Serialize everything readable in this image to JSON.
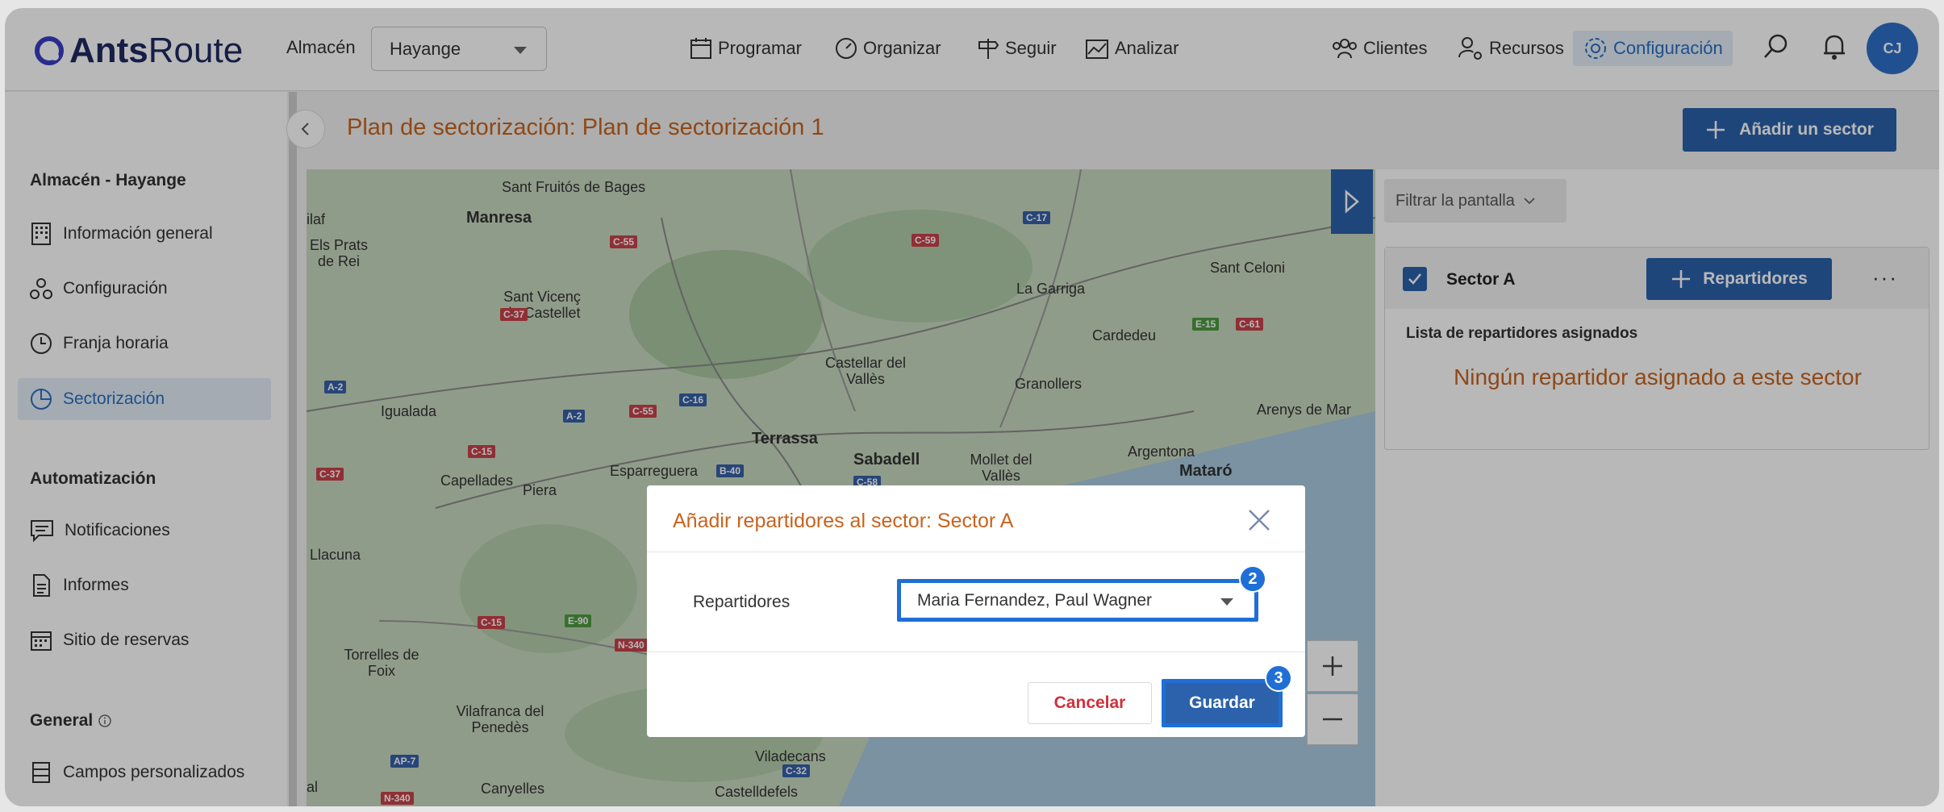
{
  "app": {
    "logo_bold": "Ants",
    "logo_rest": "Route"
  },
  "header": {
    "warehouse_label": "Almacén",
    "warehouse_value": "Hayange",
    "nav": {
      "programar": "Programar",
      "organizar": "Organizar",
      "seguir": "Seguir",
      "analizar": "Analizar",
      "clientes": "Clientes",
      "recursos": "Recursos",
      "configuracion": "Configuración"
    },
    "avatar": "CJ"
  },
  "sidebar": {
    "section1": "Almacén - Hayange",
    "items1": [
      "Información general",
      "Configuración",
      "Franja horaria",
      "Sectorización"
    ],
    "section2": "Automatización",
    "items2": [
      "Notificaciones",
      "Informes",
      "Sitio de reservas"
    ],
    "section3": "General",
    "items3": [
      "Campos personalizados"
    ]
  },
  "page": {
    "title": "Plan de sectorización: Plan de sectorización 1",
    "add_sector": "Añadir un sector"
  },
  "map": {
    "labels": [
      "Sant Fruitós de Bages",
      "Manresa",
      "Sant Vicenç de Castellet",
      "La Garriga",
      "Sant Celoni",
      "Els Prats de Rei",
      "Cardedeu",
      "Castellar del Vallès",
      "Granollers",
      "Igualada",
      "Arenys de Mar",
      "Terrassa",
      "Sabadell",
      "Argentona",
      "Mataró",
      "Capellades",
      "Piera",
      "Esparreguera",
      "Mollet del Vallès",
      "Llacuna",
      "Torrelles de Foix",
      "Vilafranca del Penedès",
      "Viladecans",
      "Canyelles",
      "Castelldefels",
      "ilaf",
      "al"
    ],
    "roads": [
      "C-55",
      "C-59",
      "C-17",
      "C-37",
      "E-15",
      "C-61",
      "A-2",
      "C-55",
      "C-16",
      "A-2",
      "C-15",
      "B-40",
      "C-58",
      "C-37",
      "C-15",
      "E-90",
      "N-340",
      "AP-7",
      "C-32",
      "N-340"
    ]
  },
  "right_panel": {
    "filter": "Filtrar la pantalla",
    "sector_name": "Sector A",
    "add_drivers": "Repartidores",
    "assigned_title": "Lista de repartidores asignados",
    "empty_msg": "Ningún repartidor asignado a este sector"
  },
  "modal": {
    "title": "Añadir repartidores al sector: Sector A",
    "field_label": "Repartidores",
    "field_value": "Maria Fernandez, Paul Wagner",
    "badge_select": "2",
    "badge_save": "3",
    "cancel": "Cancelar",
    "save": "Guardar"
  },
  "colors": {
    "accent": "#2c62ab",
    "highlight": "#1f6fd6",
    "orange_text": "#c8641e",
    "danger": "#d0303c"
  }
}
